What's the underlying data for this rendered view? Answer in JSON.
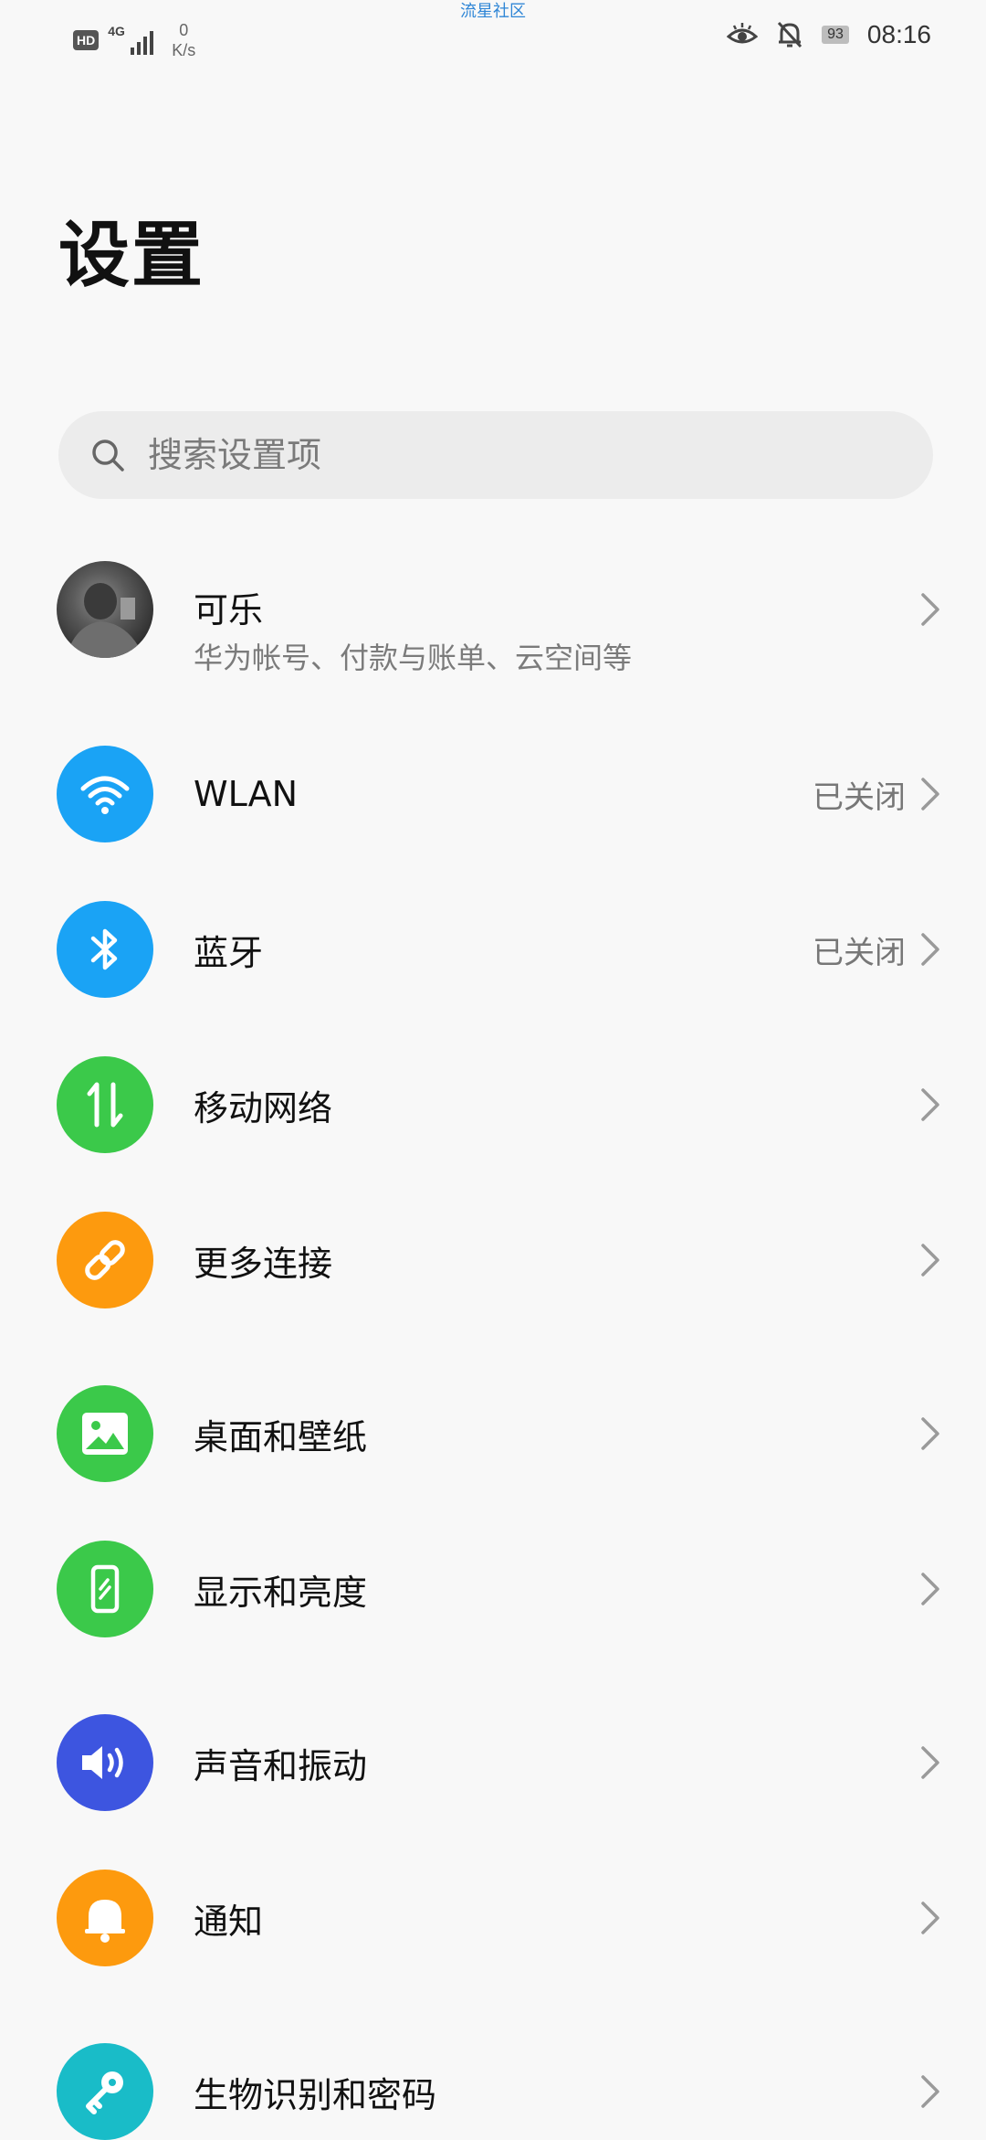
{
  "status_bar": {
    "watermark": "流星社区",
    "hd": "HD",
    "network": "4G",
    "speed_value": "0",
    "speed_unit": "K/s",
    "battery": "93",
    "time": "08:16"
  },
  "page": {
    "title": "设置"
  },
  "search": {
    "placeholder": "搜索设置项"
  },
  "profile": {
    "name": "可乐",
    "subtitle": "华为帐号、付款与账单、云空间等"
  },
  "items": [
    {
      "label": "WLAN",
      "status": "已关闭",
      "icon": "wifi-icon",
      "color": "#1aa3f5"
    },
    {
      "label": "蓝牙",
      "status": "已关闭",
      "icon": "bluetooth-icon",
      "color": "#1aa3f5"
    },
    {
      "label": "移动网络",
      "status": "",
      "icon": "mobile-data-icon",
      "color": "#3bc94a"
    },
    {
      "label": "更多连接",
      "status": "",
      "icon": "link-icon",
      "color": "#fd9a0e"
    },
    {
      "label": "桌面和壁纸",
      "status": "",
      "icon": "wallpaper-icon",
      "color": "#3bc94a"
    },
    {
      "label": "显示和亮度",
      "status": "",
      "icon": "display-icon",
      "color": "#3bc94a"
    },
    {
      "label": "声音和振动",
      "status": "",
      "icon": "sound-icon",
      "color": "#3d55e0"
    },
    {
      "label": "通知",
      "status": "",
      "icon": "bell-icon",
      "color": "#fd9a0e"
    },
    {
      "label": "生物识别和密码",
      "status": "",
      "icon": "key-icon",
      "color": "#19bcc8"
    }
  ]
}
